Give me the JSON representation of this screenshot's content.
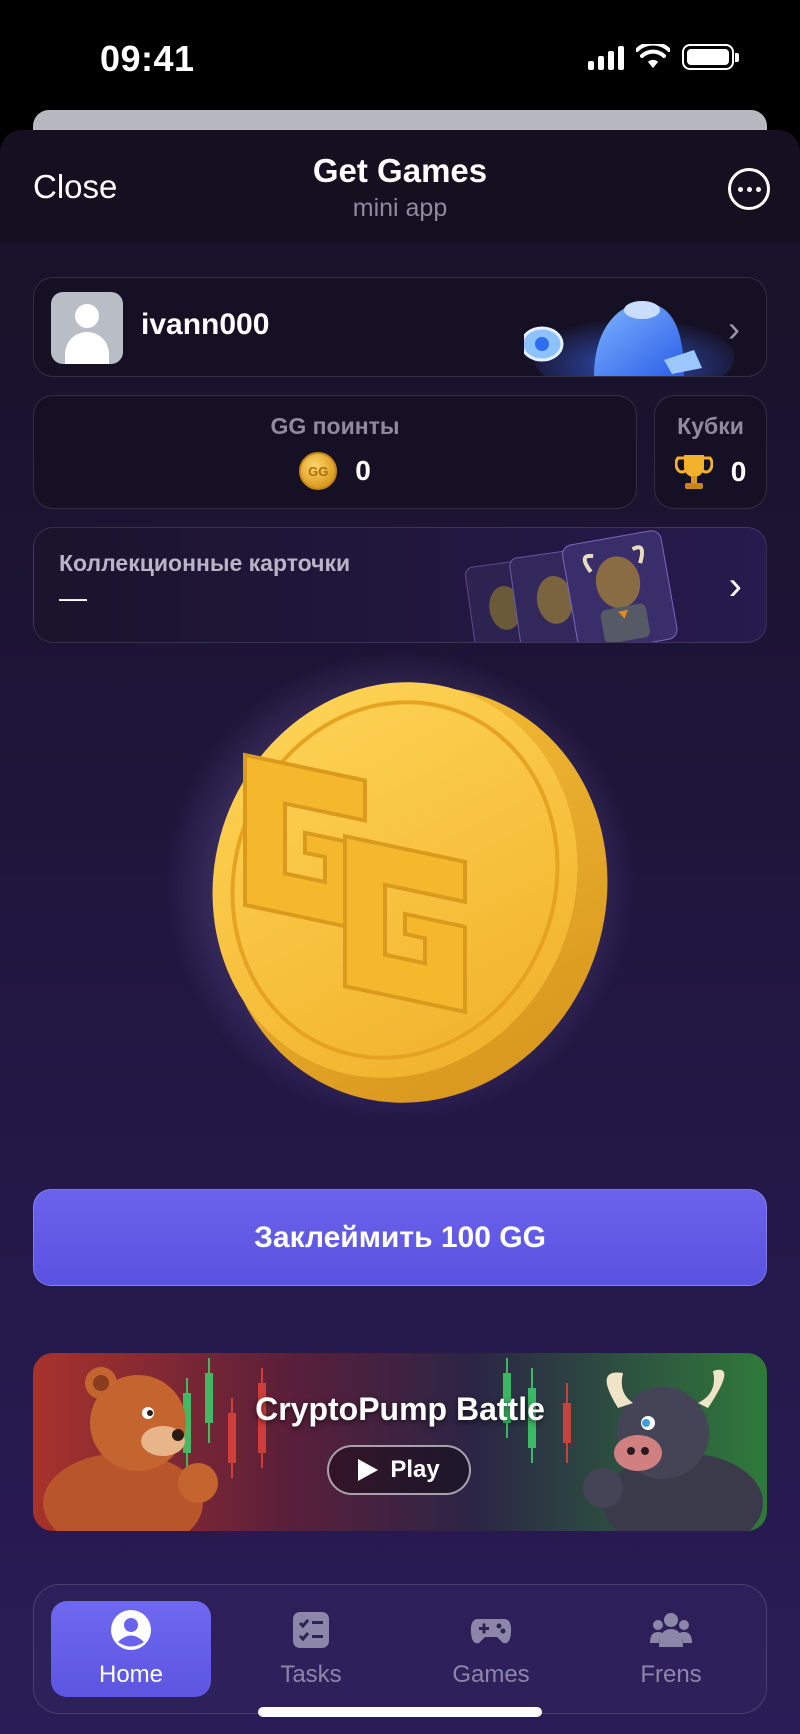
{
  "status_bar": {
    "time": "09:41"
  },
  "header": {
    "close_label": "Close",
    "title": "Get Games",
    "subtitle": "mini app"
  },
  "profile": {
    "username": "ivann000"
  },
  "stats": {
    "points_label": "GG поинты",
    "points_value": "0",
    "cups_label": "Кубки",
    "cups_value": "0"
  },
  "collectibles": {
    "title": "Коллекционные карточки",
    "value": "—"
  },
  "claim": {
    "label": "Заклеймить 100 GG"
  },
  "banner": {
    "title": "CryptoPump Battle",
    "play_label": "Play"
  },
  "tabbar": {
    "active": "Home",
    "items": [
      {
        "label": "Home",
        "icon": "person-icon"
      },
      {
        "label": "Tasks",
        "icon": "checklist-icon"
      },
      {
        "label": "Games",
        "icon": "gamepad-icon"
      },
      {
        "label": "Frens",
        "icon": "friends-icon"
      }
    ]
  },
  "colors": {
    "accent": "#5f58e6",
    "background_top": "#171227",
    "background_bottom": "#2a1c56",
    "coin_gold": "#f3b62b"
  }
}
